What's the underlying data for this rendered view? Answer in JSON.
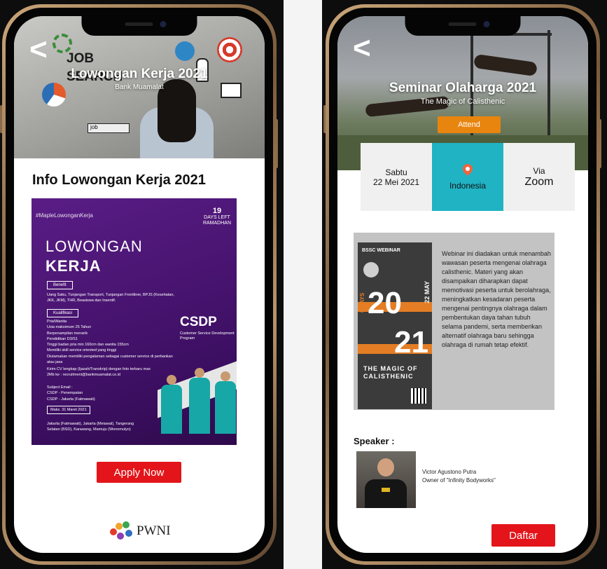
{
  "left_screen": {
    "hero": {
      "title": "Lowongan Kerja 2021",
      "subtitle": "Bank Muamalat",
      "doodle_job": "JOB",
      "doodle_search": "SEARCH",
      "doodle_searchbox": "job"
    },
    "section_title": "Info Lowongan Kerja 2021",
    "poster": {
      "hashtag": "#MapleLowonganKerja",
      "days_left": "19",
      "days_left_label": "DAYS LEFT",
      "days_left_sub": "RAMADHAN",
      "headline_1": "LOWONGAN",
      "headline_2": "KERJA",
      "benefit_label": "Benefit",
      "benefit_text": "Uang Saku, Tunjangan Transport, Tunjangan Frontliner, BPJS (Kesehatan, JKK, JKM), THR, Beasiswa dan Insentif.",
      "qualification_label": "Kualifikasi",
      "qualifications": [
        "Pria/Wanita",
        "Usia maksimum 25 Tahun",
        "Berpenampilan menarik",
        "Pendidikan D3/S1",
        "Tinggi badan pria min 160cm dan wanita 155cm",
        "Memiliki skill service oriented yang tinggi",
        "Diutamakan memiliki pengalaman sebagai customer service di perbankan atau jasa"
      ],
      "cv_text": "Kirim CV lengkap (Ijazah/Transkrip) dengan foto terbaru max 2Mb ke : recruitment@bankmuamalat.co.id",
      "subject_title": "Subject Email :",
      "subject_1": "CSDP - Penempatan",
      "subject_2": "CSDP - Jakarta (Fatmawati)",
      "deadline": "Maks. 31 Maret 2021",
      "locations": "Jakarta (Fatmawati), Jakarta (Meiawal), Tangerang Selatan (BSD), Karawang, Mamuju (Wonomulyo)",
      "program_name": "CSDP",
      "program_sub": "Customer Service Development Program"
    },
    "apply_button": "Apply Now",
    "logo_text": "PWNI"
  },
  "right_screen": {
    "hero": {
      "title": "Seminar Olaharga 2021",
      "subtitle": "The Magic of Calisthenic"
    },
    "attend_button": "Attend",
    "info": {
      "day": "Sabtu",
      "date": "22 Mei 2021",
      "location": "Indonesia",
      "via_label": "Via",
      "via_platform": "Zoom"
    },
    "webinar_poster": {
      "header": "BSSC WEBINAR",
      "year_top": "20",
      "year_bottom": "21",
      "date_vertical": "22 MAY",
      "days": "6 DAYS",
      "magic_line_1": "THE MAGIC OF",
      "magic_line_2": "CALISTHENIC"
    },
    "description": "Webinar ini diadakan untuk menambah wawasan peserta mengenai olahraga calisthenic. Materi yang akan disampaikan diharapkan dapat memotivasi peserta untuk berolahraga, meningkatkan kesadaran peserta mengenai pentingnya olahraga dalam pembentukan daya tahan tubuh selama pandemi, serta memberikan alternatif olahraga baru sehingga olahraga di rumah tetap efektif.",
    "speaker_label": "Speaker :",
    "speaker_name": "Victor Agustono Putra",
    "speaker_role": "Owner of \"Infinity Bodyworks\"",
    "daftar_button": "Daftar"
  },
  "colors": {
    "primary_red": "#e3151a",
    "attend_orange": "#e8850f",
    "location_teal": "#1fb3c4",
    "poster_purple": "#4a1673"
  }
}
